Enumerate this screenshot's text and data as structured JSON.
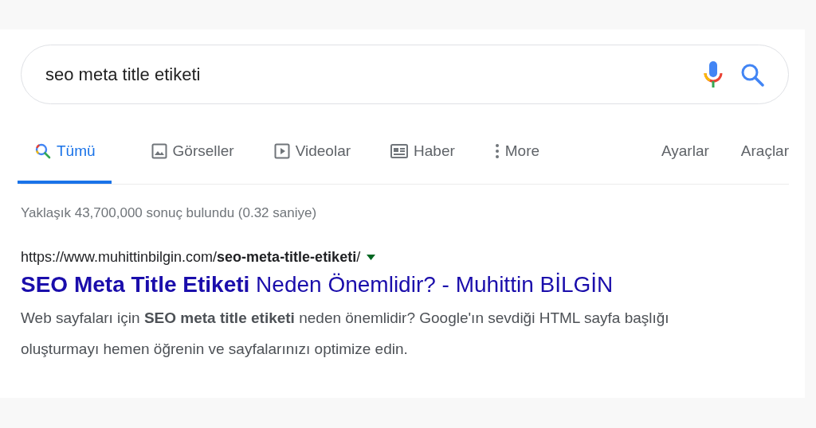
{
  "search": {
    "value": "seo meta title etiketi"
  },
  "tabs": [
    {
      "label": "Tümü",
      "kind": "all",
      "selected": true
    },
    {
      "label": "Görseller",
      "kind": "images",
      "selected": false
    },
    {
      "label": "Videolar",
      "kind": "videos",
      "selected": false
    },
    {
      "label": "Haber",
      "kind": "news",
      "selected": false
    },
    {
      "label": "More",
      "kind": "more",
      "selected": false
    }
  ],
  "tools": [
    "Ayarlar",
    "Araçlar"
  ],
  "result_stats": "Yaklaşık 43,700,000 sonuç bulundu (0.32 saniye)",
  "result": {
    "url": "https://www.muhittinbilgin.com/**seo-meta-title-etiketi**/",
    "title": "**SEO Meta Title Etiketi** Neden Önemlidir? - Muhittin BİLGİN",
    "snippet": "Web sayfaları için **SEO meta title etiketi** neden önemlidir? Google'ın sevdiği HTML sayfa başlığı oluşturmayı hemen öğrenin ve sayfalarınızı optimize edin."
  }
}
